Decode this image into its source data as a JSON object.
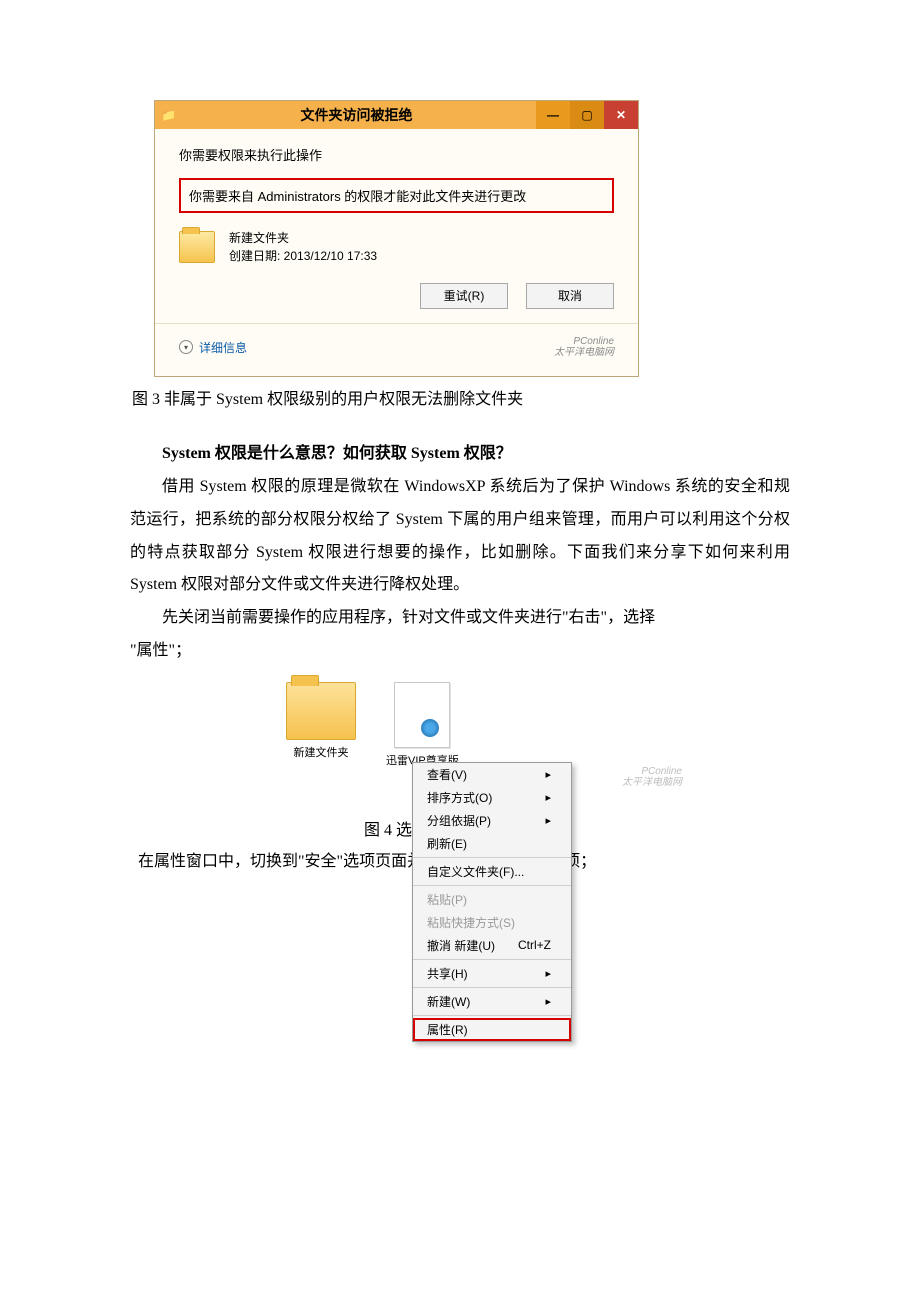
{
  "dialog1": {
    "title": "文件夹访问被拒绝",
    "line1": "你需要权限来执行此操作",
    "redbox": "你需要来自 Administrators 的权限才能对此文件夹进行更改",
    "folder_name": "新建文件夹",
    "created_line": "创建日期: 2013/12/10 17:33",
    "retry_btn": "重试(R)",
    "cancel_btn": "取消",
    "details": "详细信息",
    "watermark1": "PConline",
    "watermark2": "太平洋电脑网"
  },
  "caption3": "图 3 非属于 System 权限级别的用户权限无法删除文件夹",
  "heading": "System 权限是什么意思？如何获取 System 权限？",
  "para1": "借用 System 权限的原理是微软在 WindowsXP 系统后为了保护 Windows 系统的安全和规范运行，把系统的部分权限分权给了 System 下属的用户组来管理，而用户可以利用这个分权的特点获取部分 System 权限进行想要的操作，比如删除。下面我们来分享下如何来利用 System 权限对部分文件或文件夹进行降权处理。",
  "para2a": "先关闭当前需要操作的应用程序，针对文件或文件夹进行\"右击\"，选择",
  "para2b": "\"属性\"；",
  "desktop": {
    "folder_label": "新建文件夹",
    "file_label": "迅雷VIP尊享版"
  },
  "ctx": {
    "view": "查看(V)",
    "sort": "排序方式(O)",
    "group": "分组依据(P)",
    "refresh": "刷新(E)",
    "custom": "自定义文件夹(F)...",
    "paste": "粘贴(P)",
    "paste_shortcut": "粘贴快捷方式(S)",
    "undo": "撤消 新建(U)",
    "undo_key": "Ctrl+Z",
    "share": "共享(H)",
    "new": "新建(W)",
    "props": "属性(R)"
  },
  "watermark_fig4a": "PConline",
  "watermark_fig4b": "太平洋电脑网",
  "caption4": "图 4 选择文件或文件夹属性",
  "after_fig4": "在属性窗口中，切换到\"安全\"选项页面并点击下方的\"高级\"选项；"
}
